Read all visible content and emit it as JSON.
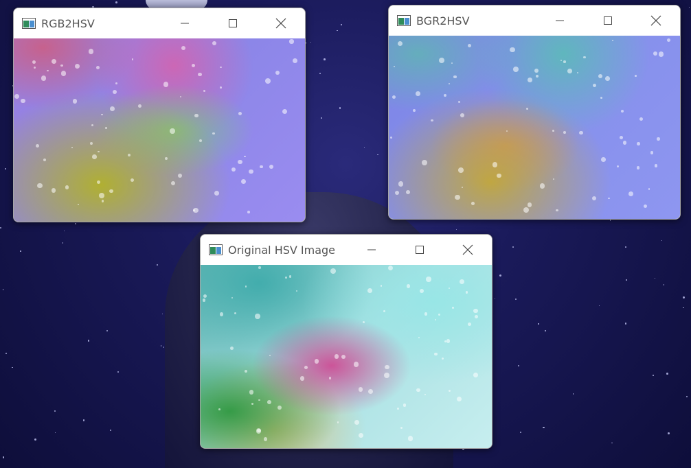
{
  "windows": [
    {
      "id": "w1",
      "title": "RGB2HSV"
    },
    {
      "id": "w2",
      "title": "BGR2HSV"
    },
    {
      "id": "w3",
      "title": "Original HSV Image"
    }
  ],
  "icons": {
    "app": "image-window-icon",
    "minimize": "minimize-icon",
    "maximize": "maximize-icon",
    "close": "close-icon"
  }
}
